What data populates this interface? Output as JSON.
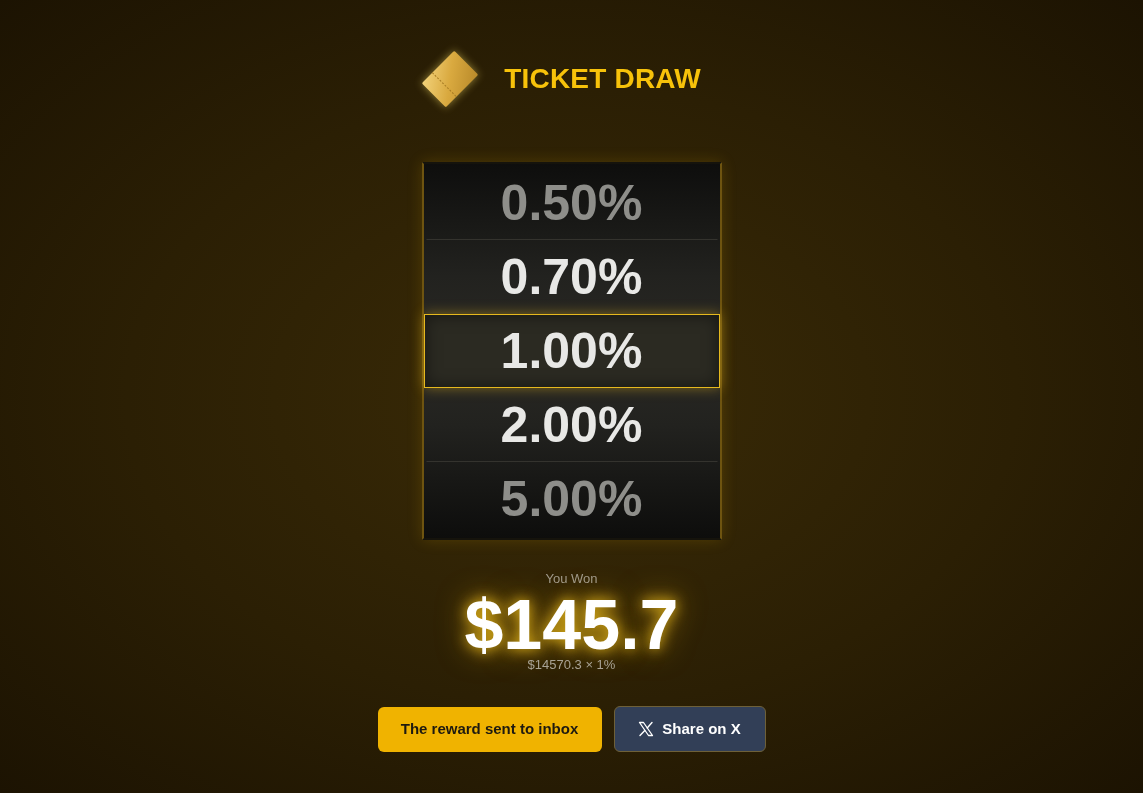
{
  "header": {
    "title": "TICKET DRAW"
  },
  "reel": {
    "items": [
      {
        "label": "0.50%",
        "selected": false
      },
      {
        "label": "0.70%",
        "selected": false
      },
      {
        "label": "1.00%",
        "selected": true
      },
      {
        "label": "2.00%",
        "selected": false
      },
      {
        "label": "5.00%",
        "selected": false
      }
    ]
  },
  "result": {
    "label": "You Won",
    "amount": "$145.7",
    "formula": "$14570.3 × 1%"
  },
  "buttons": [
    {
      "kind": "primary",
      "label": "The reward sent to inbox"
    },
    {
      "kind": "share",
      "label": "Share on X"
    }
  ]
}
